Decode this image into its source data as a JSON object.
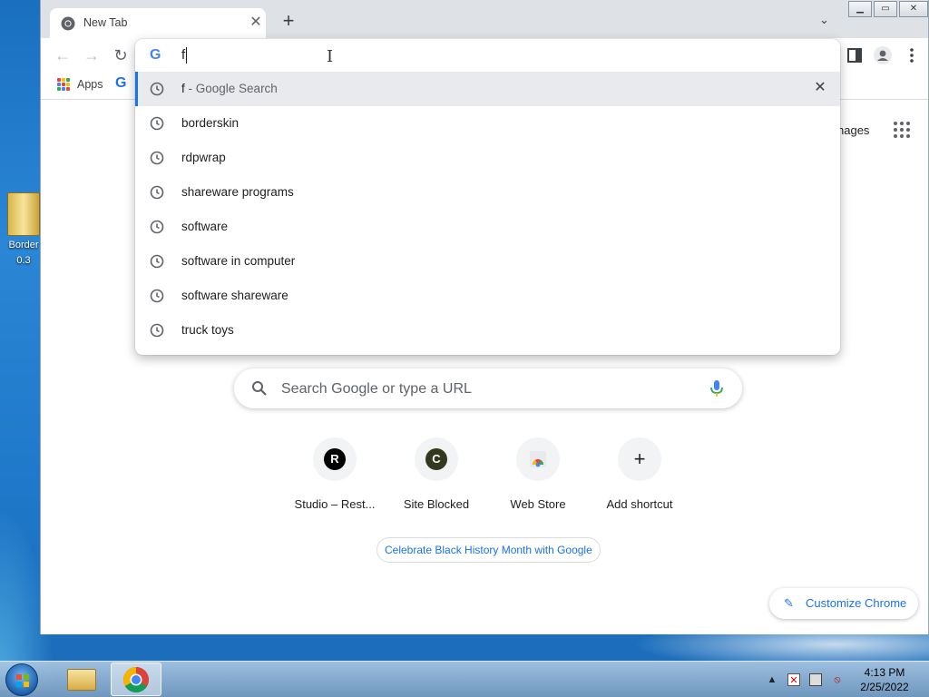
{
  "desktop": {
    "icon_label_line1": "Border",
    "icon_label_line2": "0.3"
  },
  "browser": {
    "tab": {
      "title": "New Tab",
      "close_symbol": "✕"
    },
    "new_tab_symbol": "+",
    "tab_search_symbol": "⌄",
    "window_controls": {
      "minimize": "▁",
      "maximize": "▭",
      "close": "✕"
    },
    "nav": {
      "back": "←",
      "forward": "→",
      "reload": "↻"
    },
    "bookmarks_bar": {
      "apps_label": "Apps",
      "apps_colors": [
        "#ea4335",
        "#fbbc04",
        "#34a853",
        "#4285f4",
        "#ea4335",
        "#fbbc04",
        "#34a853",
        "#4285f4",
        "#ea4335"
      ]
    }
  },
  "omnibox": {
    "input_value": "f",
    "suggestions": [
      {
        "text": "f",
        "sub": " - Google Search",
        "selected": true
      },
      {
        "text": "borderskin",
        "sub": ""
      },
      {
        "text": "rdpwrap",
        "sub": ""
      },
      {
        "text": "shareware programs",
        "sub": ""
      },
      {
        "text": "software",
        "sub": ""
      },
      {
        "text": "software in computer",
        "sub": ""
      },
      {
        "text": "software shareware",
        "sub": ""
      },
      {
        "text": "truck toys",
        "sub": ""
      }
    ],
    "remove_symbol": "✕"
  },
  "newtab": {
    "images_link": "nages",
    "search_placeholder": "Search Google or type a URL",
    "shortcuts": [
      {
        "label": "Studio – Rest...",
        "letter": "R",
        "color": "#000000"
      },
      {
        "label": "Site Blocked",
        "letter": "C",
        "color": "#33391f"
      },
      {
        "label": "Web Store",
        "letter": "",
        "color": ""
      },
      {
        "label": "Add shortcut",
        "letter": "+",
        "color": ""
      }
    ],
    "doodle_link": "Celebrate Black History Month with Google",
    "customize_label": "Customize Chrome"
  },
  "taskbar": {
    "time": "4:13 PM",
    "date": "2/25/2022"
  },
  "colors": {
    "accent": "#1a73e8",
    "tab_strip": "#dee1e6"
  }
}
